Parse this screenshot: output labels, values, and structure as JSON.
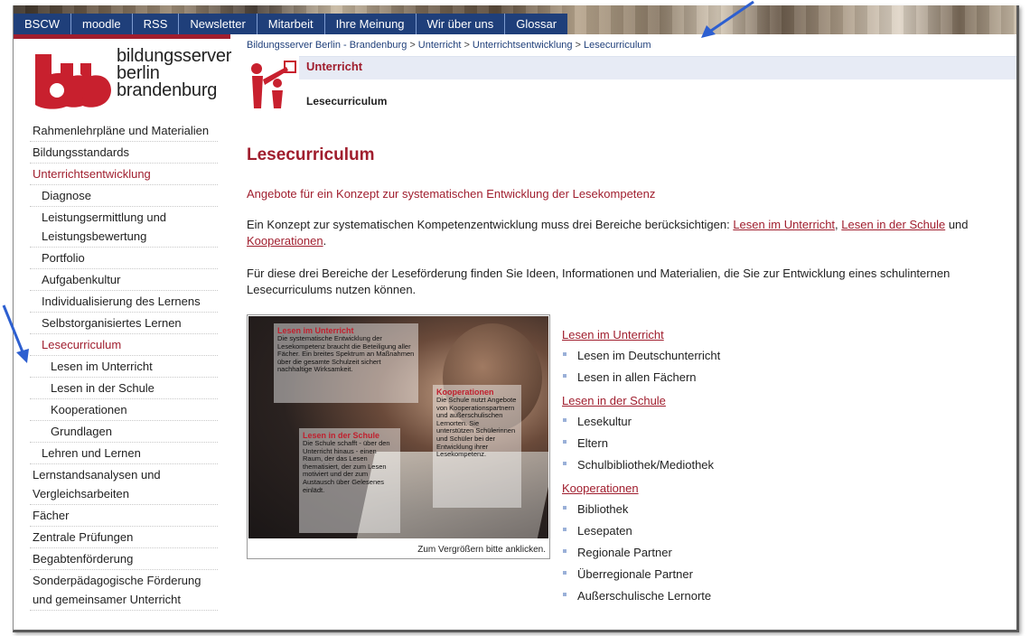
{
  "topnav": {
    "items": [
      "BSCW",
      "moodle",
      "RSS",
      "Newsletter",
      "Mitarbeit",
      "Ihre Meinung",
      "Wir über uns",
      "Glossar"
    ]
  },
  "logo": {
    "line1": "bildungsserver",
    "line2": "berlin",
    "line3": "brandenburg"
  },
  "breadcrumb": [
    "Bildungsserver Berlin - Brandenburg",
    "Unterricht",
    "Unterrichtsentwicklung",
    "Lesecurriculum"
  ],
  "section": {
    "title": "Unterricht",
    "subtitle": "Lesecurriculum"
  },
  "sidebar": {
    "items": [
      {
        "label": "Rahmenlehrpläne und Materialien"
      },
      {
        "label": "Bildungsstandards"
      },
      {
        "label": "Unterrichtsentwicklung"
      },
      {
        "label": "Diagnose"
      },
      {
        "label": "Leistungsermittlung und Leistungsbewertung"
      },
      {
        "label": "Portfolio"
      },
      {
        "label": "Aufgabenkultur"
      },
      {
        "label": "Individualisierung des Lernens"
      },
      {
        "label": "Selbstorganisiertes Lernen"
      },
      {
        "label": "Lesecurriculum"
      },
      {
        "label": "Lesen im Unterricht"
      },
      {
        "label": "Lesen in der Schule"
      },
      {
        "label": "Kooperationen"
      },
      {
        "label": "Grundlagen"
      },
      {
        "label": "Lehren und Lernen"
      },
      {
        "label": "Lernstandsanalysen und Vergleichsarbeiten"
      },
      {
        "label": "Fächer"
      },
      {
        "label": "Zentrale Prüfungen"
      },
      {
        "label": "Begabtenförderung"
      },
      {
        "label": "Sonderpädagogische Förderung und gemeinsamer Unterricht"
      }
    ]
  },
  "content": {
    "title": "Lesecurriculum",
    "lead": "Angebote für ein Konzept zur systematischen Entwicklung der Lesekompetenz",
    "para1_text": "Ein Konzept zur systematischen Kompetenzentwicklung muss drei Bereiche berücksichtigen: ",
    "para1_link1": "Lesen im Unterricht",
    "para1_sep": ", ",
    "para1_link2": "Lesen in der Schule",
    "para1_and": " und ",
    "para1_link3": "Kooperationen",
    "para1_end": ".",
    "para2": "Für diese drei Bereiche der Leseförderung finden Sie Ideen, Informationen und Materialien, die Sie zur Entwicklung eines schulinternen Lesecurriculums nutzen können."
  },
  "figure": {
    "box1_title": "Lesen im Unterricht",
    "box1_text": "Die systematische Entwicklung der Lesekompetenz braucht die Beteiligung aller Fächer. Ein breites Spektrum an Maßnahmen über die gesamte Schulzeit sichert nachhaltige Wirksamkeit.",
    "box2_title": "Kooperationen",
    "box2_text": "Die Schule nutzt Angebote von Kooperationspartnern und außerschulischen Lernorten. Sie unterstützen Schülerinnen und Schüler bei der Entwicklung ihrer Lesekompetenz.",
    "box3_title": "Lesen in der Schule",
    "box3_text": "Die Schule schafft - über den Unterricht hinaus - einen Raum, der das Lesen thematisiert, der zum Lesen motiviert und der zum Austausch über Gelesenes einlädt.",
    "caption": "Zum Vergrößern bitte anklicken."
  },
  "linklists": [
    {
      "title": "Lesen im Unterricht",
      "items": [
        "Lesen im Deutschunterricht",
        "Lesen in allen Fächern"
      ]
    },
    {
      "title": "Lesen in der Schule",
      "items": [
        "Lesekultur",
        "Eltern",
        "Schulbibliothek/Mediothek"
      ]
    },
    {
      "title": "Kooperationen",
      "items": [
        "Bibliothek",
        "Lesepaten",
        "Regionale Partner",
        "Überregionale Partner",
        "Außerschulische Lernorte"
      ]
    }
  ],
  "colors": {
    "accent_red": "#a01e2e",
    "nav_blue": "#1f3f7a",
    "band_blue": "#e7ebf5",
    "arrow_blue": "#2d5fd0"
  }
}
